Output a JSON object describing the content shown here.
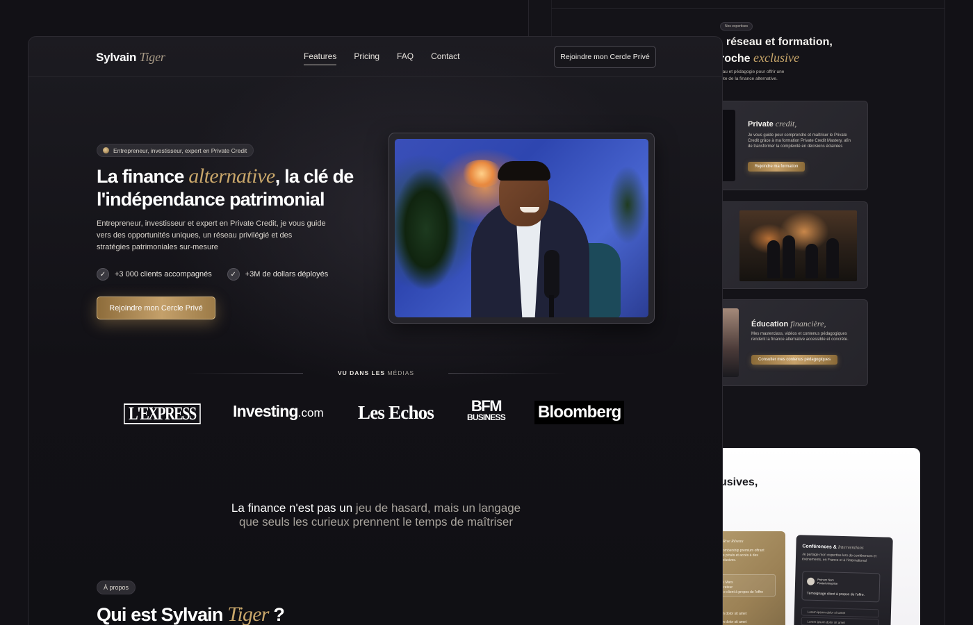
{
  "background": {
    "badge": "Nos expertises",
    "heading_a": ", réseau et formation,",
    "heading_b": "roche",
    "heading_b_it": "exclusive",
    "sub": "eau et pédagogie pour offrir une\nlète de la finance alternative.",
    "card_credit": {
      "title": "Private",
      "title_it": "credit,",
      "text": "Je vous guide pour comprendre et maîtriser le Private Credit grâce à ma formation Private Credit Mastery, afin de transformer la complexité en décisions éclairées",
      "button": "Rejoindre ma formation"
    },
    "card_education": {
      "title": "Éducation",
      "title_it": "financière,",
      "text": "Mes masterclass, vidéos et contenus pédagogiques rendent la finance alternative accessible et concrète.",
      "button": "Consulter mes contenus pédagogiques"
    },
    "white_heading": "usives,",
    "gold_card": {
      "title": "Rive Réseau",
      "t1": "ombership premium offrant\ns privés et accès à des\nclusives.",
      "t2": "i Mars\nrateur",
      "t3": "e client à propos de l'offre",
      "t4": "n dolor sit amet",
      "t5": "n dolor sit amet"
    },
    "dark_card": {
      "title": "Conférences &",
      "title_it": "Interventions",
      "text": "Je partage mon expertise lors de conférences et événements, en France et à l'international",
      "testi_name": "Prénom Nom\nPoste/entreprise",
      "testi_text": "Témoignage client à propos de l'offre.",
      "li1": "Lorem ipsum dolor sit amet",
      "li2": "Lorem ipsum dolor sit amet"
    }
  },
  "nav": {
    "logo_main": "Sylvain",
    "logo_it": "Tiger",
    "links": [
      "Features",
      "Pricing",
      "FAQ",
      "Contact"
    ],
    "active": "Features",
    "cta": "Rejoindre mon Cercle Privé"
  },
  "hero": {
    "pill": "Entrepreneur, investisseur, expert en Private Credit",
    "title_a": "La finance",
    "title_it": "alternative",
    "title_b": ", la clé de",
    "title_c": "l'indépendance patrimonial",
    "desc": "Entrepreneur, investisseur et expert en Private Credit, je vous guide vers des opportunités uniques, un réseau privilégié et des stratégies patrimoniales sur-mesure",
    "stat1": "+3 000 clients accompagnés",
    "stat2": "+3M de dollars déployés",
    "cta": "Rejoindre mon Cercle Privé"
  },
  "media": {
    "label_strong": "VU DANS LES",
    "label_light": "MÉDIAS",
    "logos": {
      "express": "L'EXPRESS",
      "investing": "Investing",
      "investing_dc": ".com",
      "echos": "Les Echos",
      "bfm1": "BFM",
      "bfm2": "BUSINESS",
      "bloomberg": "Bloomberg"
    }
  },
  "quote": {
    "hl": "La finance n'est pas un",
    "rest": " jeu de hasard, mais un langage",
    "line2": "que seuls les curieux prennent le temps de maîtriser"
  },
  "about": {
    "pill": "À propos",
    "title": "Qui est Sylvain",
    "title_it": "Tiger",
    "title_q": " ?"
  },
  "colors": {
    "gold": "#c8a66a",
    "bg": "#121116"
  },
  "icons": {
    "check": "check-icon",
    "pill_dot": "coin-icon"
  }
}
